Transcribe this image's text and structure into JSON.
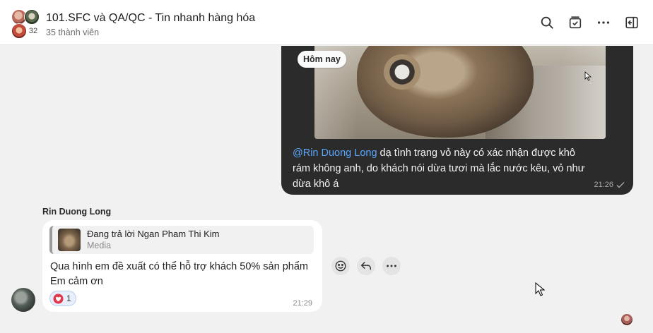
{
  "header": {
    "title": "101.SFC và QA/QC - Tin nhanh hàng hóa",
    "subtitle": "35 thành viên",
    "avatar_count": "32",
    "icons": [
      "search-icon",
      "pinned-messages-icon",
      "more-icon",
      "toggle-sidebar-icon"
    ]
  },
  "own_message": {
    "date_chip": "Hôm nay",
    "mention": "@Rin Duong Long",
    "text": " dạ tình trạng vỏ này có xác nhận được khô rám không anh, do khách nói dừa tươi mà lắc nước kêu, vỏ như dừa khô á",
    "time": "21:26"
  },
  "incoming_message": {
    "sender": "Rin Duong Long",
    "reply_title": "Đang trả lời Ngan Pham Thi Kim",
    "reply_sub": "Media",
    "line1": "Qua hình em đề xuất có thể hỗ trợ khách 50% sản phẩm",
    "line2": "Em cảm ơn",
    "reaction_count": "1",
    "time": "21:29"
  },
  "actions": [
    "emoji-react-icon",
    "reply-icon",
    "more-actions-icon"
  ],
  "colors": {
    "own_bubble": "#2b2b2b",
    "mention": "#5aa7ff",
    "background": "#f1f1f1"
  }
}
